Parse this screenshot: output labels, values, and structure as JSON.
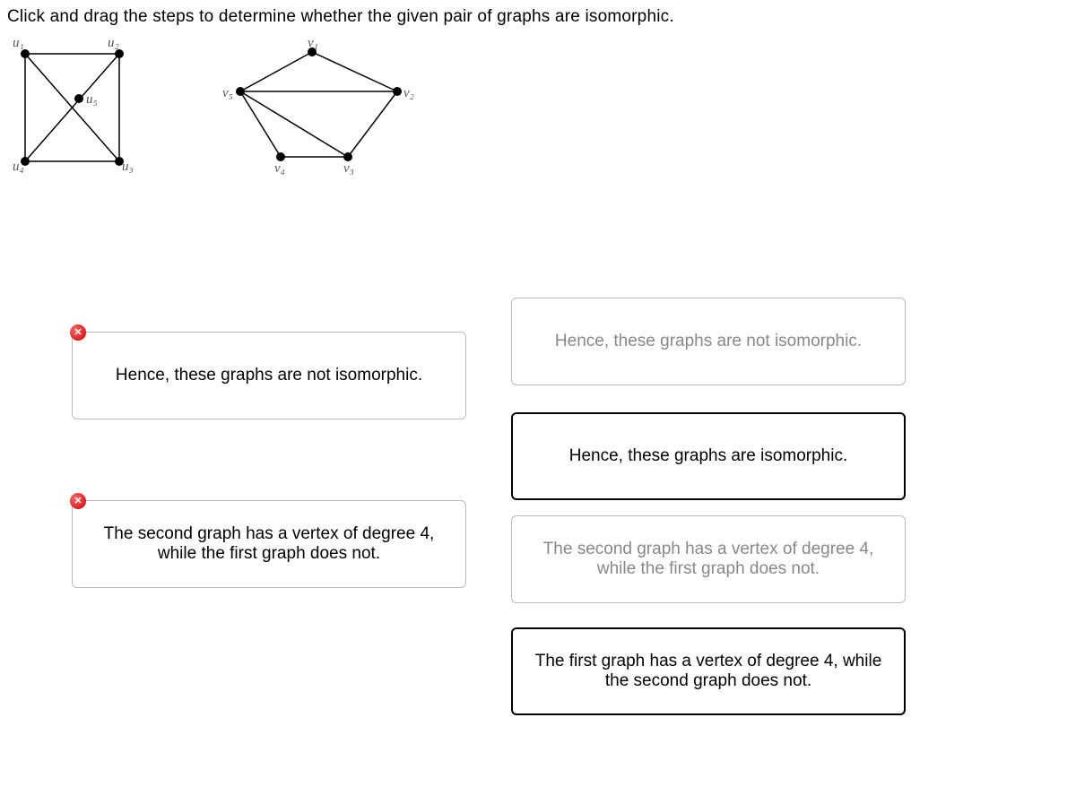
{
  "instruction": "Click and drag the steps to determine whether the given pair of graphs are isomorphic.",
  "graphs": {
    "g1": {
      "labels": {
        "u1": "u₁",
        "u2": "u₂",
        "u3": "u₃",
        "u4": "u₄",
        "u5": "u₅"
      }
    },
    "g2": {
      "labels": {
        "v1": "v₁",
        "v2": "v₂",
        "v3": "v₃",
        "v4": "v₄",
        "v5": "v₅"
      }
    }
  },
  "dropzones": {
    "slot1": {
      "text": "Hence, these graphs are not isomorphic."
    },
    "slot2": {
      "text": "The second graph has a vertex of degree 4, while the first graph does not."
    }
  },
  "options": {
    "opt1": {
      "text": "Hence, these graphs are not isomorphic."
    },
    "opt2": {
      "text": "Hence, these graphs are isomorphic."
    },
    "opt3": {
      "text": "The second graph has a vertex of degree 4, while the first graph does not."
    },
    "opt4": {
      "text": "The first graph has a vertex of degree 4, while the second graph does not."
    }
  }
}
